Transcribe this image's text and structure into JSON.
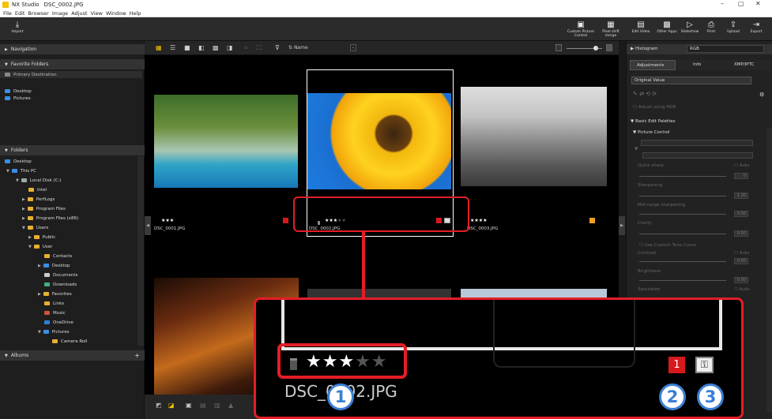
{
  "titlebar": {
    "app": "NX Studio",
    "file": "DSC_0002.JPG",
    "minimize": "–",
    "maximize": "▢",
    "close": "✕"
  },
  "menu": [
    "File",
    "Edit",
    "Browser",
    "Image",
    "Adjust",
    "View",
    "Window",
    "Help"
  ],
  "toolbar": {
    "import": "Import",
    "right": [
      "Custom Picture Control",
      "Pixel shift merge",
      "Edit Video",
      "Other Apps",
      "Slideshow",
      "Print",
      "Upload",
      "Export"
    ]
  },
  "left": {
    "navigation": "Navigation",
    "favorites": "Favorite Folders",
    "primary": "Primary Destination",
    "fav_items": [
      "Desktop",
      "Pictures"
    ],
    "folders": "Folders",
    "tree": [
      "Desktop",
      "This PC",
      "Local Disk (C:)",
      "Intel",
      "PerfLogs",
      "Program Files",
      "Program Files (x86)",
      "Users",
      "Public",
      "User",
      "Contacts",
      "Desktop",
      "Documents",
      "Downloads",
      "Favorites",
      "Links",
      "Music",
      "OneDrive",
      "Pictures",
      "Camera Roll"
    ],
    "albums": "Albums",
    "albums_add": "+"
  },
  "center": {
    "sort": "Name",
    "thumbs": [
      {
        "name": "DSC_0001.JPG",
        "rating": 3
      },
      {
        "name": "DSC_0002.JPG",
        "rating": 3
      },
      {
        "name": "DSC_0003.JPG",
        "rating": 4
      }
    ]
  },
  "right": {
    "histogram": "Histogram",
    "hist_mode": "RGB",
    "tabs": [
      "Adjustments",
      "Info",
      "XMP/IPTC"
    ],
    "preset": "Original Value",
    "adjust_hdr": "Adjust using HDR",
    "basic": "Basic Edit Palettes",
    "picture_control": "Picture Control",
    "quick_sharp": "Quick sharp",
    "sharpening": "Sharpening",
    "midrange": "Mid-range sharpening",
    "clarity": "Clarity",
    "custom_curve": "Use Custom Tone Curve",
    "contrast": "Contrast",
    "brightness": "Brightness",
    "saturation": "Saturation",
    "auto": "Auto",
    "val_0": "0",
    "val_100": "1.00",
    "val_000": "0.00"
  },
  "zoom": {
    "filename": "DSC_0002.JPG",
    "label_num": "1",
    "badges": [
      "1",
      "2",
      "3"
    ]
  },
  "colors": {
    "accent_red": "#e41e26",
    "badge_blue": "#3a7fd5",
    "folder": "#e8b030"
  }
}
